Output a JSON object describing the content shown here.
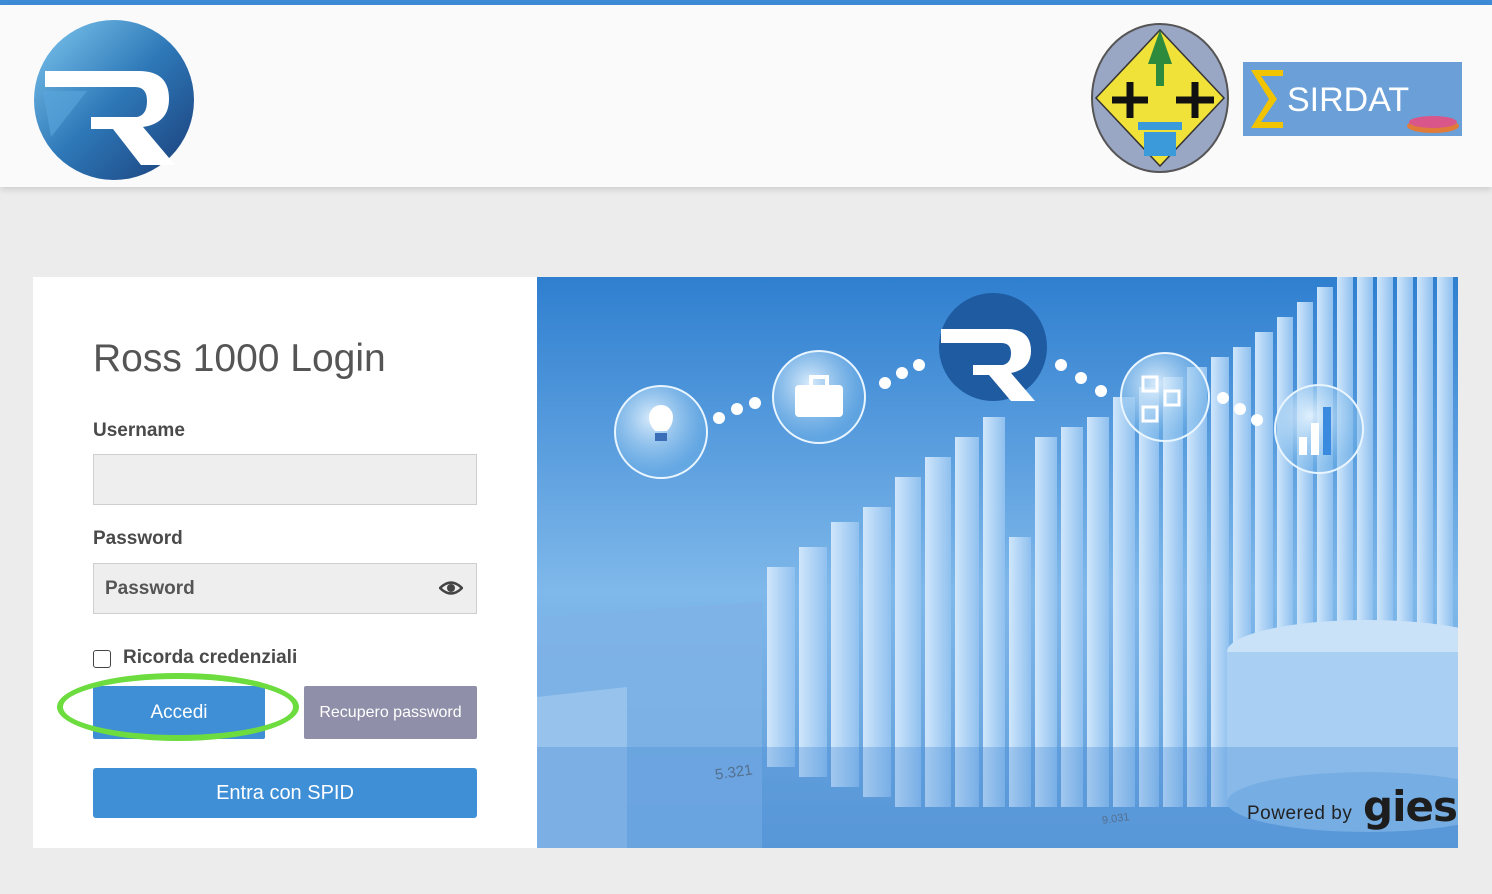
{
  "login": {
    "title": "Ross 1000 Login",
    "username_label": "Username",
    "username_value": "",
    "password_label": "Password",
    "password_placeholder": "Password",
    "remember_label": "Ricorda credenziali",
    "remember_checked": false,
    "accedi_label": "Accedi",
    "recupero_label": "Recupero password",
    "spid_label": "Entra con SPID"
  },
  "banner": {
    "powered_by": "Powered by",
    "brand": "gies",
    "numbers": [
      "5.321",
      "9.031"
    ]
  },
  "logos": {
    "header_logo_icon": "ross-r-icon",
    "region_emblem_icon": "regione-calabria-emblem-icon",
    "sirdat_text": "SIRDAT"
  },
  "colors": {
    "accent": "#3f8fd7",
    "secondary": "#8f8fa9",
    "highlight": "#6ddc3e"
  }
}
